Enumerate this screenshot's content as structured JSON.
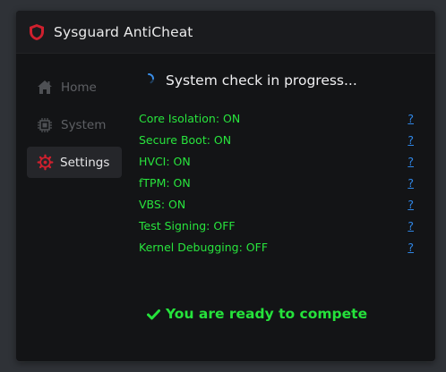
{
  "window": {
    "title": "Sysguard AntiCheat",
    "logo_icon": "shield-icon"
  },
  "sidebar": {
    "items": [
      {
        "label": "Home",
        "icon": "home-icon",
        "active": false
      },
      {
        "label": "System",
        "icon": "chip-icon",
        "active": false
      },
      {
        "label": "Settings",
        "icon": "gear-icon",
        "active": true
      }
    ]
  },
  "main": {
    "status_title": "System check in progress...",
    "checks": [
      {
        "label": "Core Isolation: ON",
        "help": "?"
      },
      {
        "label": "Secure Boot: ON",
        "help": "?"
      },
      {
        "label": "HVCI: ON",
        "help": "?"
      },
      {
        "label": "fTPM: ON",
        "help": "?"
      },
      {
        "label": "VBS: ON",
        "help": "?"
      },
      {
        "label": "Test Signing: OFF",
        "help": "?"
      },
      {
        "label": "Kernel Debugging: OFF",
        "help": "?"
      }
    ],
    "ready_message": "You are ready to compete"
  },
  "colors": {
    "accent_red": "#d0202e",
    "ok_green": "#28e43d",
    "link_blue": "#2f86e6",
    "spinner_blue": "#3a8ee8"
  }
}
